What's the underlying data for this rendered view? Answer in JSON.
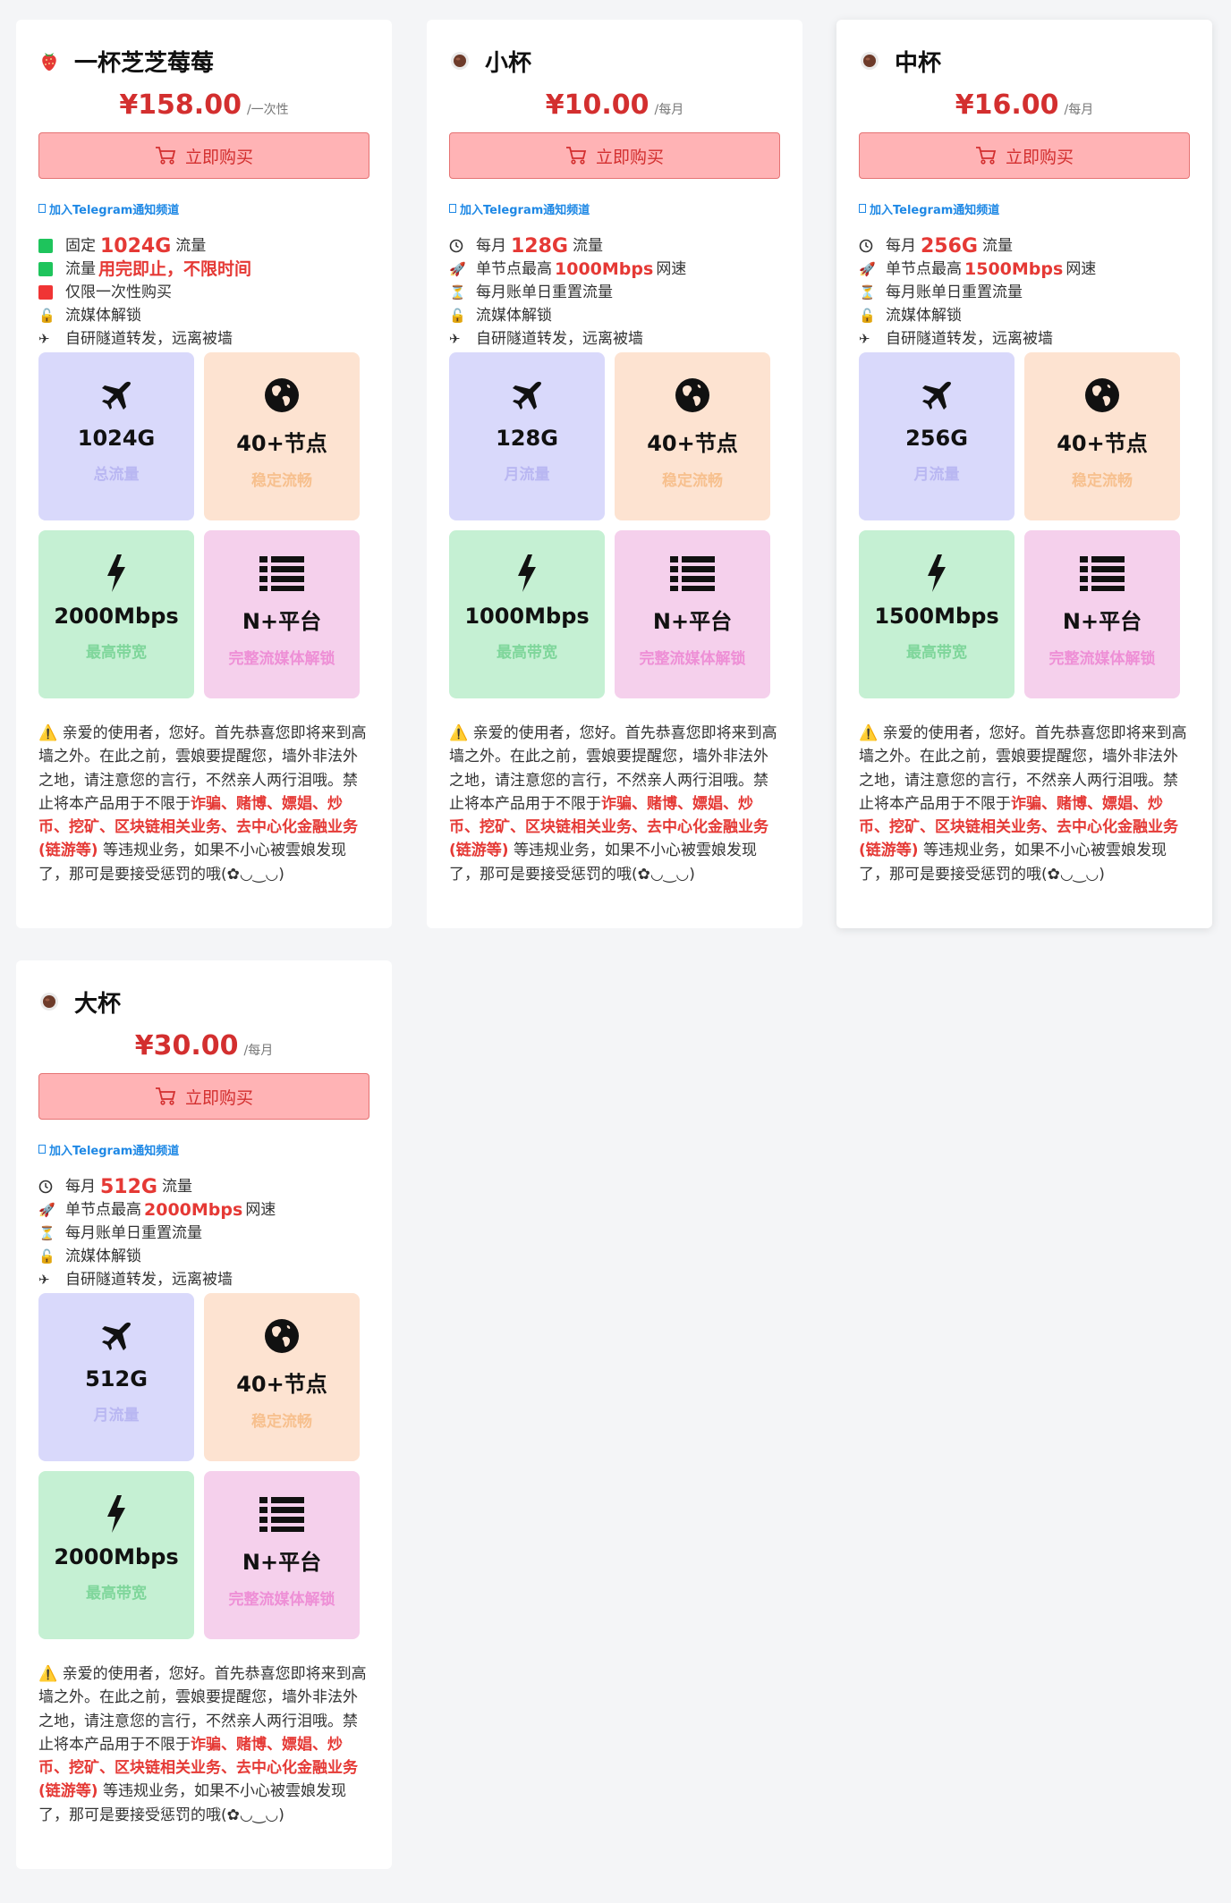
{
  "common": {
    "buy_label": "立即购买",
    "telegram_link": "加入Telegram通知频道",
    "feature_relay": "自研隧道转发，远离被墙",
    "feature_stream": "流媒体解锁",
    "feature_reset": "每月账单日重置流量",
    "nodes_value": "40+节点",
    "nodes_label": "稳定流畅",
    "platform_value": "N+平台",
    "platform_label": "完整流媒体解锁",
    "bandwidth_label": "最高带宽",
    "notice_pre": "亲爱的使用者，您好。首先恭喜您即将来到高墙之外。在此之前，雲娘要提醒您，墙外非法外之地，请注意您的言行，不然亲人两行泪哦。禁止将本产品用于不限于",
    "notice_red": "诈骗、赌博、嫖娼、炒币、挖矿、区块链相关业务、去中心化金融业务(链游等)",
    "notice_post": "等违规业务，如果不小心被雲娘发现了，那可是要接受惩罚的哦(✿◡‿◡)",
    "colors": {
      "price": "#d32f2f",
      "highlight": "#e53935",
      "buy_bg": "#ffb3b5",
      "tile_traffic": "#d9d9fb",
      "tile_nodes": "#fde3d1",
      "tile_speed": "#c5f0d3",
      "tile_platform": "#f5d0ec"
    }
  },
  "plans": [
    {
      "icon": "strawberry-icon",
      "name": "一杯芝芝莓莓",
      "price": "¥158.00",
      "unit": "/一次性",
      "f1_pre": "固定",
      "f1_val": "1024G",
      "f1_post": "流量",
      "f2_pre": "流量",
      "f2_val": "用完即止，不限时间",
      "f3": "仅限一次性购买",
      "traffic_value": "1024G",
      "traffic_label": "总流量",
      "speed_value": "2000Mbps"
    },
    {
      "icon": "coffee-icon",
      "name": "小杯",
      "price": "¥10.00",
      "unit": "/每月",
      "f1_pre": "每月",
      "f1_val": "128G",
      "f1_post": "流量",
      "f2_pre": "单节点最高",
      "f2_val": "1000Mbps",
      "f2_post": "网速",
      "traffic_value": "128G",
      "traffic_label": "月流量",
      "speed_value": "1000Mbps"
    },
    {
      "icon": "coffee-icon",
      "name": "中杯",
      "price": "¥16.00",
      "unit": "/每月",
      "f1_pre": "每月",
      "f1_val": "256G",
      "f1_post": "流量",
      "f2_pre": "单节点最高",
      "f2_val": "1500Mbps",
      "f2_post": "网速",
      "traffic_value": "256G",
      "traffic_label": "月流量",
      "speed_value": "1500Mbps"
    },
    {
      "icon": "coffee-icon",
      "name": "大杯",
      "price": "¥30.00",
      "unit": "/每月",
      "f1_pre": "每月",
      "f1_val": "512G",
      "f1_post": "流量",
      "f2_pre": "单节点最高",
      "f2_val": "2000Mbps",
      "f2_post": "网速",
      "traffic_value": "512G",
      "traffic_label": "月流量",
      "speed_value": "2000Mbps"
    }
  ]
}
